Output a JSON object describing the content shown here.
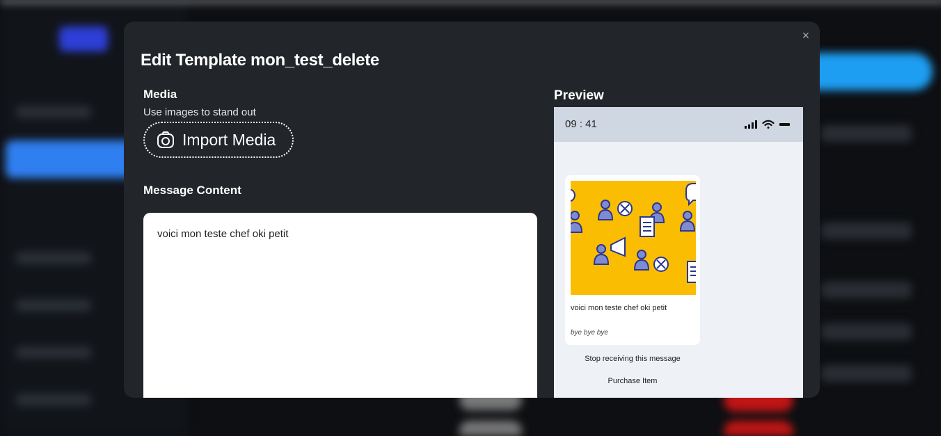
{
  "modal": {
    "title": "Edit Template mon_test_delete",
    "close_icon": "×"
  },
  "media": {
    "label": "Media",
    "subtitle": "Use images to stand out",
    "import_label": "Import Media"
  },
  "message": {
    "label": "Message Content",
    "content": "voici mon teste chef oki petit"
  },
  "preview": {
    "label": "Preview",
    "time": "09 : 41",
    "card_text": "voici mon teste chef oki petit",
    "card_footer": "bye bye bye",
    "quick_replies": [
      "Stop receiving this message",
      "Purchase Item"
    ]
  },
  "colors": {
    "modal_bg": "#22252a",
    "accent_blue": "#1e9ef2",
    "image_yellow": "#fbbd02",
    "icon_blue": "#7f8bd0",
    "icon_outline": "#2b3690"
  }
}
